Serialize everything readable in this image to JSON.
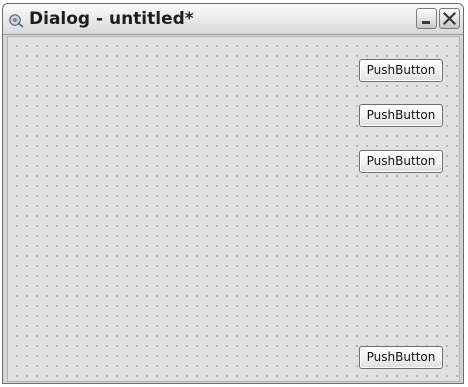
{
  "window": {
    "title": "Dialog - untitled*"
  },
  "titlebar": {
    "app_icon": "qt-designer-icon",
    "minimize_icon": "minimize-icon",
    "close_icon": "close-icon"
  },
  "form": {
    "grid": "dotted",
    "buttons": [
      {
        "label": "PushButton"
      },
      {
        "label": "PushButton"
      },
      {
        "label": "PushButton"
      },
      {
        "label": "PushButton"
      }
    ]
  }
}
